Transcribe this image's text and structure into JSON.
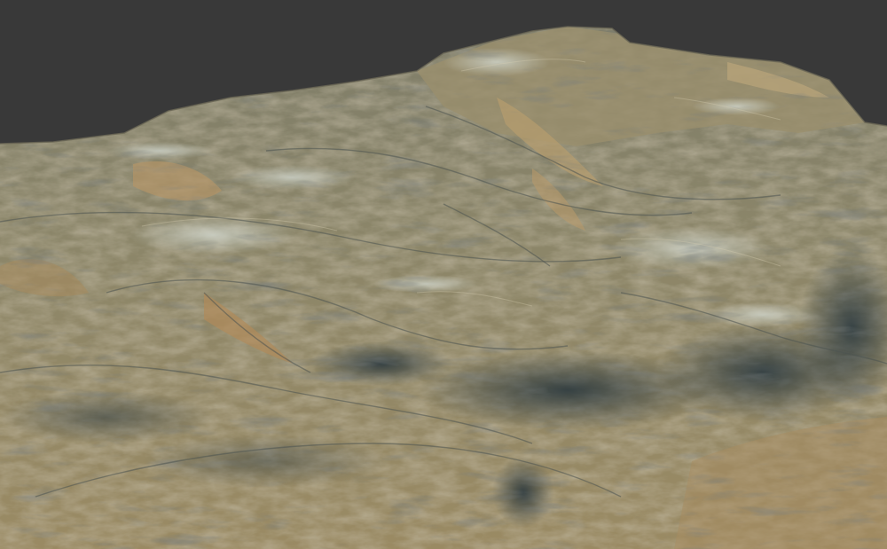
{
  "viewport": {
    "background_color": "#393939",
    "content": "3d-terrain-render"
  },
  "terrain": {
    "base_color": "#8a8468",
    "highlight_color": "#c9b98c",
    "shadow_color": "#2f3a3f",
    "snow_color": "#c8cfc8",
    "ochre_color": "#a8865a"
  }
}
